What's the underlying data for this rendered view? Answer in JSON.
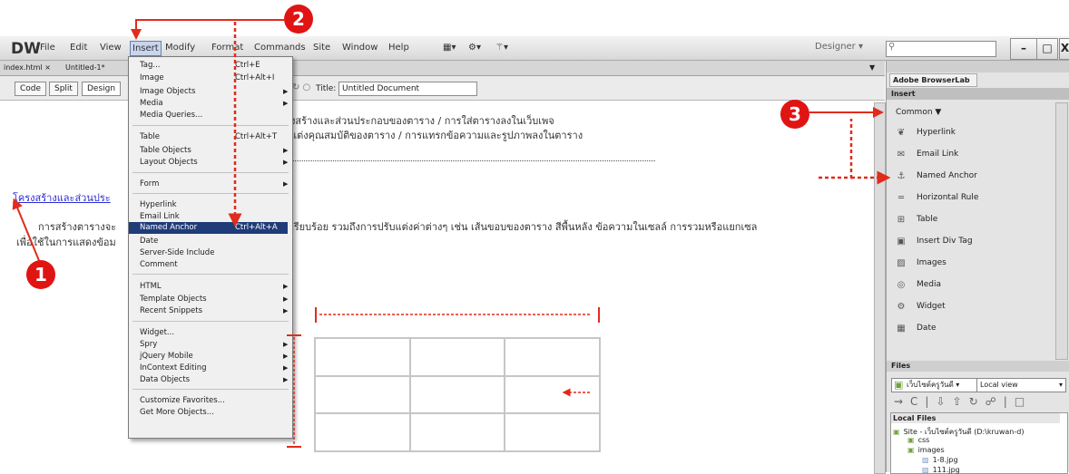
{
  "app": {
    "logo": "DW",
    "menus": [
      "File",
      "Edit",
      "View",
      "Insert",
      "Modify",
      "Format",
      "Commands",
      "Site",
      "Window",
      "Help"
    ],
    "workspace": "Designer",
    "window_buttons": [
      "–",
      "ɦ",
      "X"
    ]
  },
  "tabs": [
    "index.html",
    "Untitled-1*"
  ],
  "view_buttons": [
    "Code",
    "Split",
    "Design"
  ],
  "title_label": "Title:",
  "title_value": "Untitled Document",
  "document": {
    "line1": "งสร้างและส่วนประกอบของตาราง / การใส่ตารางลงในเว็บเพจ",
    "line2": "แต่งคุณสมบัติของตาราง / การแทรกข้อความและรูปภาพลงในตาราง",
    "anchor_link": "โครงสร้างและส่วนประ",
    "para1_start": "การสร้างตารางจะ",
    "para1_end": "เรียบร้อย รวมถึงการปรับแต่งค่าต่างๆ เช่น เส้นขอบของตาราง สีพื้นหลัง ข้อความในเซลล์ การรวมหรือแยกเซล",
    "para2": "เพื่อใช้ในการแสดงข้อม"
  },
  "insert_menu": {
    "items": [
      {
        "label": "Tag...",
        "shortcut": "Ctrl+E",
        "sub": false
      },
      {
        "label": "Image",
        "shortcut": "Ctrl+Alt+I",
        "sub": false
      },
      {
        "label": "Image Objects",
        "shortcut": "",
        "sub": true
      },
      {
        "label": "Media",
        "shortcut": "",
        "sub": true
      },
      {
        "label": "Media Queries...",
        "shortcut": "",
        "sub": false
      },
      {
        "label": "Table",
        "shortcut": "Ctrl+Alt+T",
        "sub": false
      },
      {
        "label": "Table Objects",
        "shortcut": "",
        "sub": true
      },
      {
        "label": "Layout Objects",
        "shortcut": "",
        "sub": true
      },
      {
        "label": "Form",
        "shortcut": "",
        "sub": true
      },
      {
        "label": "Hyperlink",
        "shortcut": "",
        "sub": false
      },
      {
        "label": "Email Link",
        "shortcut": "",
        "sub": false
      },
      {
        "label": "Named Anchor",
        "shortcut": "Ctrl+Alt+A",
        "sub": false
      },
      {
        "label": "Date",
        "shortcut": "",
        "sub": false
      },
      {
        "label": "Server-Side Include",
        "shortcut": "",
        "sub": false
      },
      {
        "label": "Comment",
        "shortcut": "",
        "sub": false
      },
      {
        "label": "HTML",
        "shortcut": "",
        "sub": true
      },
      {
        "label": "Template Objects",
        "shortcut": "",
        "sub": true
      },
      {
        "label": "Recent Snippets",
        "shortcut": "",
        "sub": true
      },
      {
        "label": "Widget...",
        "shortcut": "",
        "sub": false
      },
      {
        "label": "Spry",
        "shortcut": "",
        "sub": true
      },
      {
        "label": "jQuery Mobile",
        "shortcut": "",
        "sub": true
      },
      {
        "label": "InContext Editing",
        "shortcut": "",
        "sub": true
      },
      {
        "label": "Data Objects",
        "shortcut": "",
        "sub": true
      },
      {
        "label": "Customize Favorites...",
        "shortcut": "",
        "sub": false
      },
      {
        "label": "Get More Objects...",
        "shortcut": "",
        "sub": false
      }
    ],
    "highlighted": "Named Anchor"
  },
  "right_panel": {
    "browser_lab": "Adobe BrowserLab",
    "insert_tab": "Insert",
    "category": "Common",
    "items": [
      {
        "label": "Hyperlink",
        "icon": "hyperlink-icon",
        "glyph": "❦"
      },
      {
        "label": "Email Link",
        "icon": "email-link-icon",
        "glyph": "✉"
      },
      {
        "label": "Named Anchor",
        "icon": "named-anchor-icon",
        "glyph": "⚓"
      },
      {
        "label": "Horizontal Rule",
        "icon": "horizontal-rule-icon",
        "glyph": "═"
      },
      {
        "label": "Table",
        "icon": "table-icon",
        "glyph": "⊞"
      },
      {
        "label": "Insert Div Tag",
        "icon": "div-tag-icon",
        "glyph": "▣"
      },
      {
        "label": "Images",
        "icon": "images-icon",
        "glyph": "▨"
      },
      {
        "label": "Media",
        "icon": "media-icon",
        "glyph": "◎"
      },
      {
        "label": "Widget",
        "icon": "widget-icon",
        "glyph": "⚙"
      },
      {
        "label": "Date",
        "icon": "date-icon",
        "glyph": "▦"
      }
    ],
    "files_tab": "Files",
    "site_select": "เว็บไซต์ครูวันดี",
    "view_select": "Local view",
    "local_files_label": "Local Files",
    "tree": [
      {
        "label": "Site - เว็บไซต์ครูวันดี (D:\\kruwan-d)",
        "level": 0,
        "kind": "site"
      },
      {
        "label": "css",
        "level": 1,
        "kind": "folder"
      },
      {
        "label": "images",
        "level": 1,
        "kind": "folder"
      },
      {
        "label": "1-8.jpg",
        "level": 2,
        "kind": "file"
      },
      {
        "label": "111.jpg",
        "level": 2,
        "kind": "file"
      }
    ]
  },
  "annotations": [
    "1",
    "2",
    "3"
  ],
  "colors": {
    "annotation": "#e11414",
    "highlight": "#1f3c78",
    "link": "#2b2bd4"
  }
}
